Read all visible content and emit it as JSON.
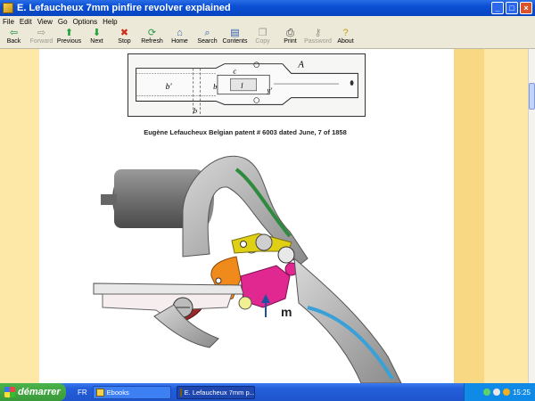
{
  "window": {
    "title": "E. Lefaucheux 7mm pinfire revolver explained",
    "controls": [
      "_",
      "□",
      "×"
    ]
  },
  "menu": [
    "File",
    "Edit",
    "View",
    "Go",
    "Options",
    "Help"
  ],
  "toolbar": [
    {
      "label": "Back",
      "icon": "back-arrow-icon",
      "glyph": "⇦",
      "color": "#1c8c3c",
      "enabled": true
    },
    {
      "label": "Forward",
      "icon": "forward-arrow-icon",
      "glyph": "⇨",
      "color": "#9c9a90",
      "enabled": false
    },
    {
      "label": "Previous",
      "icon": "up-arrow-icon",
      "glyph": "⬆",
      "color": "#1ea03a",
      "enabled": true
    },
    {
      "label": "Next",
      "icon": "down-arrow-icon",
      "glyph": "⬇",
      "color": "#1ea03a",
      "enabled": true
    },
    {
      "label": "Stop",
      "icon": "stop-icon",
      "glyph": "✖",
      "color": "#d02a1a",
      "enabled": true
    },
    {
      "label": "Refresh",
      "icon": "refresh-icon",
      "glyph": "⟳",
      "color": "#2a9a4a",
      "enabled": true
    },
    {
      "label": "Home",
      "icon": "home-icon",
      "glyph": "⌂",
      "color": "#2f5fb0",
      "enabled": true
    },
    {
      "label": "Search",
      "icon": "search-icon",
      "glyph": "⌕",
      "color": "#2f5fb0",
      "enabled": true
    },
    {
      "label": "Contents",
      "icon": "contents-icon",
      "glyph": "▤",
      "color": "#2f5fb0",
      "enabled": true
    },
    {
      "label": "Copy",
      "icon": "copy-icon",
      "glyph": "❐",
      "color": "#9c9a90",
      "enabled": false
    },
    {
      "label": "Print",
      "icon": "print-icon",
      "glyph": "⎙",
      "color": "#333333",
      "enabled": true
    },
    {
      "label": "Password",
      "icon": "key-icon",
      "glyph": "⚷",
      "color": "#9c9a90",
      "enabled": false
    },
    {
      "label": "About",
      "icon": "about-icon",
      "glyph": "?",
      "color": "#c8a010",
      "enabled": true
    }
  ],
  "content": {
    "patent_labels": {
      "A": "A",
      "b_prime": "b'",
      "c": "c",
      "b": "b",
      "l": "l",
      "y": "y'",
      "b_bottom": "b"
    },
    "caption": "Eugène Lefaucheux Belgian patent # 6003 dated June, 7 of 1858",
    "illustration_label": "m"
  },
  "taskbar": {
    "start_label": "démarrer",
    "language": "FR",
    "tasks": [
      {
        "label": "Ebooks",
        "active": false
      },
      {
        "label": "E. Lefaucheux 7mm p...",
        "active": true
      }
    ],
    "clock": "15:25"
  },
  "colors": {
    "accent": "#0a4fd4",
    "left_band": "#fde8a8",
    "right_band": "#f9d884"
  }
}
